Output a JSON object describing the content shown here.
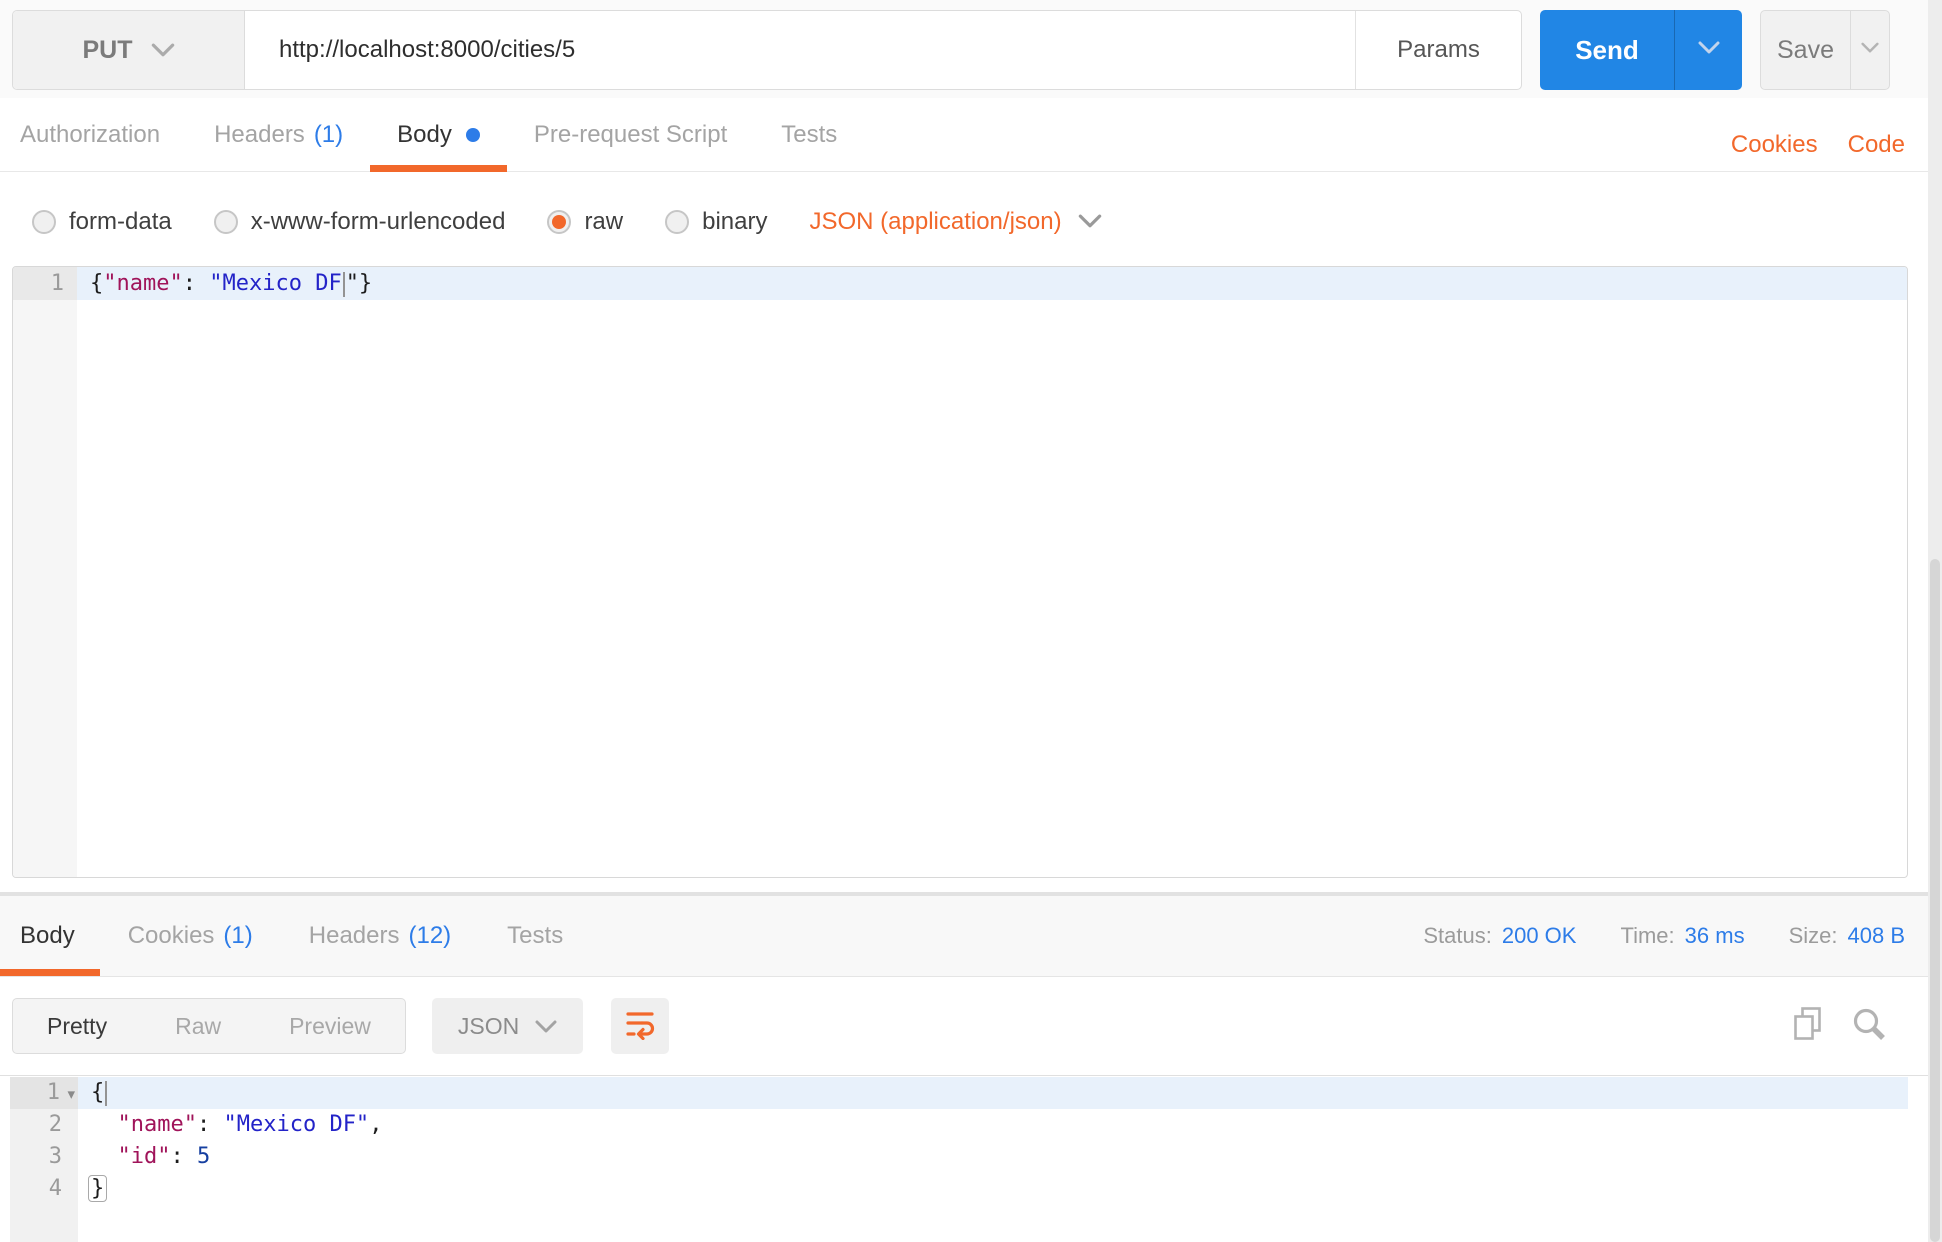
{
  "request": {
    "method": "PUT",
    "url": "http://localhost:8000/cities/5",
    "params_label": "Params",
    "send_label": "Send",
    "save_label": "Save",
    "tabs": {
      "authorization": "Authorization",
      "headers": "Headers",
      "headers_count": "(1)",
      "body": "Body",
      "prerequest": "Pre-request Script",
      "tests": "Tests"
    },
    "links": {
      "cookies": "Cookies",
      "code": "Code"
    },
    "body_type": {
      "form_data": "form-data",
      "urlencoded": "x-www-form-urlencoded",
      "raw": "raw",
      "binary": "binary",
      "selected": "raw",
      "content_type": "JSON (application/json)"
    },
    "editor": {
      "line_number": "1",
      "tok_open": "{",
      "tok_key": "\"name\"",
      "tok_colon": ": ",
      "tok_string": "\"Mexico DF",
      "tok_close": "\"}"
    }
  },
  "response": {
    "tabs": {
      "body": "Body",
      "cookies": "Cookies",
      "cookies_count": "(1)",
      "headers": "Headers",
      "headers_count": "(12)",
      "tests": "Tests"
    },
    "meta": {
      "status_label": "Status:",
      "status_value": "200 OK",
      "time_label": "Time:",
      "time_value": "36 ms",
      "size_label": "Size:",
      "size_value": "408 B"
    },
    "toolbar": {
      "pretty": "Pretty",
      "raw": "Raw",
      "preview": "Preview",
      "active_view": "Pretty",
      "language": "JSON"
    },
    "body": {
      "line_numbers": [
        "1",
        "2",
        "3",
        "4"
      ],
      "l1_open": "{",
      "l2_indent": "  ",
      "l2_key": "\"name\"",
      "l2_colon": ": ",
      "l2_string": "\"Mexico DF\"",
      "l2_comma": ",",
      "l3_indent": "  ",
      "l3_key": "\"id\"",
      "l3_colon": ": ",
      "l3_value": "5",
      "l4_close": "}"
    }
  },
  "colors": {
    "accent_orange": "#F2682B",
    "link_blue": "#2D7CE8",
    "send_blue": "#2186E5",
    "code_key": "#A0145A",
    "code_string": "#2323C8",
    "code_number": "#163FA0",
    "active_line_bg": "#E8F1FB"
  }
}
